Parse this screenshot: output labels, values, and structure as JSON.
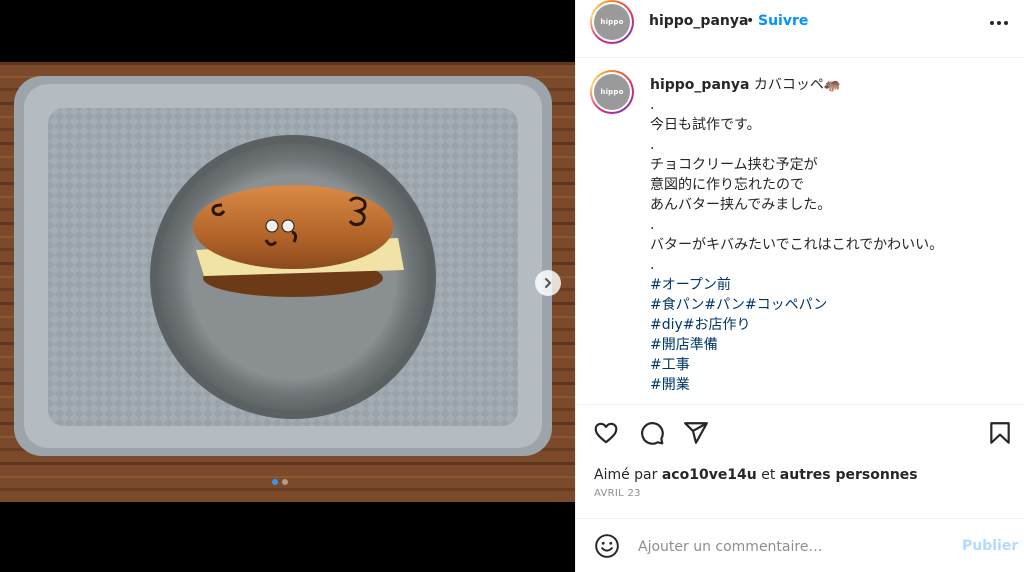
{
  "post": {
    "image_alt": "hippo-shaped bread with butter on a grey plate and tray",
    "carousel": {
      "total": 2,
      "current": 1
    }
  },
  "header": {
    "avatar_text": "hippo",
    "username": "hippo_panya",
    "separator": "•",
    "follow_label": "Suivre"
  },
  "caption": {
    "username": "hippo_panya",
    "first_line": "カバコッペ🦛",
    "lines": [
      ".",
      "今日も試作です。",
      ".",
      "チョコクリーム挟む予定が",
      "意図的に作り忘れたので",
      "あんバター挟んでみました。",
      ".",
      "バターがキバみたいでこれはこれでかわいい。",
      "."
    ],
    "hashtags": [
      "#オープン前",
      "#食パン#パン#コッペパン",
      "#diy#お店作り",
      "#開店準備",
      "#工事",
      "#開業"
    ]
  },
  "likes": {
    "prefix": "Aimé par",
    "user": "aco10ve14u",
    "middle": "et",
    "suffix": "autres personnes"
  },
  "date": "AVRIL 23",
  "comment": {
    "placeholder": "Ajouter un commentaire…",
    "publish_label": "Publier"
  },
  "colors": {
    "accent": "#0095f6",
    "hashtag": "#00376b",
    "publish_disabled": "#b3dbff",
    "meta": "#8e8e8e"
  }
}
